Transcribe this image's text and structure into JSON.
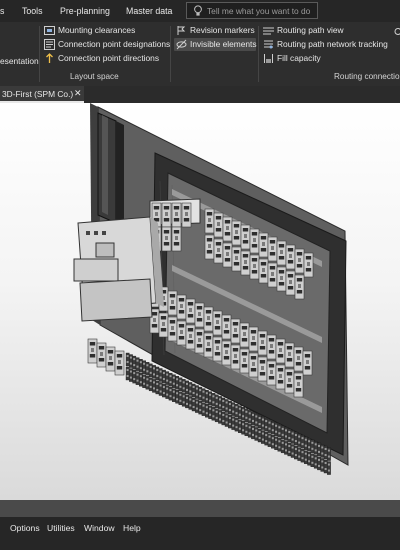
{
  "menu": {
    "items": [
      "s",
      "Tools",
      "Pre-planning",
      "Master data"
    ],
    "search_placeholder": "Tell me what you want to do"
  },
  "ribbon": {
    "left_cut_label": "esentation",
    "layout_space": {
      "items": [
        "Mounting clearances",
        "Connection point designations",
        "Connection point directions"
      ],
      "group_label": "Layout space"
    },
    "view": {
      "items": [
        "Revision markers",
        "Invisible elements"
      ],
      "selected": "Invisible elements"
    },
    "routing": {
      "items": [
        "Routing path view",
        "Routing path network tracking",
        "Fill capacity"
      ],
      "group_label": "Routing connection"
    }
  },
  "document_tab": {
    "title": "3D-First (SPM Co.)",
    "close": "✕"
  },
  "bottom_menu": {
    "items": [
      "Options",
      "Utilities",
      "Window",
      "Help"
    ]
  },
  "colors": {
    "menubar": "#262626",
    "ribbon": "#2e2e2e",
    "selected": "#4a4a4a",
    "viewport_top": "#ffffff",
    "viewport_bottom": "#dadada"
  }
}
